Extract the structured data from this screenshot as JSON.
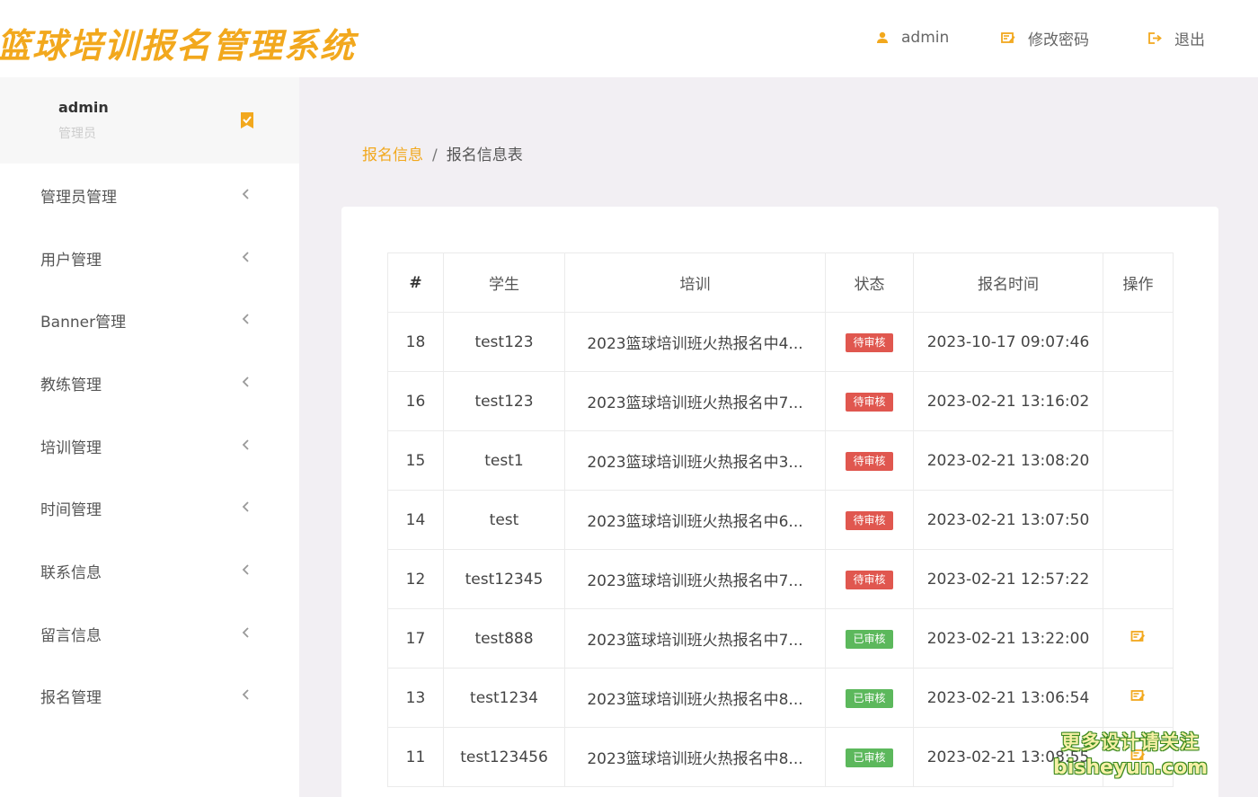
{
  "header": {
    "logo_text": "篮球培训报名管理系统",
    "user_label": "admin",
    "change_password_label": "修改密码",
    "logout_label": "退出"
  },
  "colors": {
    "accent": "#f2a81d",
    "pending": "#e0574f",
    "approved": "#5cb85c"
  },
  "sidebar": {
    "user": {
      "name": "admin",
      "role": "管理员"
    },
    "items": [
      {
        "label": "管理员管理"
      },
      {
        "label": "用户管理"
      },
      {
        "label": "Banner管理"
      },
      {
        "label": "教练管理"
      },
      {
        "label": "培训管理"
      },
      {
        "label": "时间管理"
      },
      {
        "label": "联系信息"
      },
      {
        "label": "留言信息"
      },
      {
        "label": "报名管理"
      }
    ]
  },
  "breadcrumb": {
    "parent": "报名信息",
    "separator": "/",
    "current": "报名信息表"
  },
  "table": {
    "columns": [
      "#",
      "学生",
      "培训",
      "状态",
      "报名时间",
      "操作"
    ],
    "rows": [
      {
        "id": "18",
        "student": "test123",
        "training": "2023篮球培训班火热报名中4...",
        "status": "待审核",
        "time": "2023-10-17 09:07:46",
        "action": false
      },
      {
        "id": "16",
        "student": "test123",
        "training": "2023篮球培训班火热报名中7...",
        "status": "待审核",
        "time": "2023-02-21 13:16:02",
        "action": false
      },
      {
        "id": "15",
        "student": "test1",
        "training": "2023篮球培训班火热报名中3...",
        "status": "待审核",
        "time": "2023-02-21 13:08:20",
        "action": false
      },
      {
        "id": "14",
        "student": "test",
        "training": "2023篮球培训班火热报名中6...",
        "status": "待审核",
        "time": "2023-02-21 13:07:50",
        "action": false
      },
      {
        "id": "12",
        "student": "test12345",
        "training": "2023篮球培训班火热报名中7...",
        "status": "待审核",
        "time": "2023-02-21 12:57:22",
        "action": false
      },
      {
        "id": "17",
        "student": "test888",
        "training": "2023篮球培训班火热报名中7...",
        "status": "已审核",
        "time": "2023-02-21 13:22:00",
        "action": true
      },
      {
        "id": "13",
        "student": "test1234",
        "training": "2023篮球培训班火热报名中8...",
        "status": "已审核",
        "time": "2023-02-21 13:06:54",
        "action": true
      },
      {
        "id": "11",
        "student": "test123456",
        "training": "2023篮球培训班火热报名中8...",
        "status": "已审核",
        "time": "2023-02-21 13:08:55",
        "action": true
      }
    ]
  },
  "watermark": {
    "line1": "更多设计请关注",
    "line2": "bisheyun.com"
  }
}
